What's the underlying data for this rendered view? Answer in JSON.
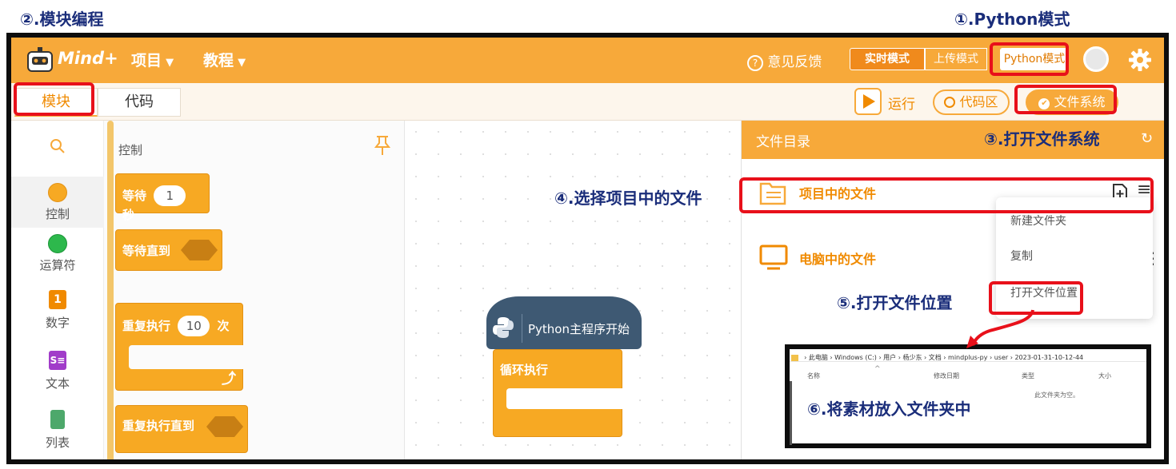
{
  "annotations": {
    "a1": "①.Python模式",
    "a2": "②.模块编程",
    "a3": "③.打开文件系统",
    "a4": "④.选择项目中的文件",
    "a5": "⑤.打开文件位置",
    "a6": "⑥.将素材放入文件夹中"
  },
  "topbar": {
    "logo_text": "Mind+",
    "menu_project": "项目",
    "menu_tutorial": "教程",
    "feedback": "意见反馈",
    "mode_realtime": "实时模式",
    "mode_upload": "上传模式",
    "mode_python": "Python模式"
  },
  "subbar": {
    "tab_blocks": "模块",
    "tab_code": "代码",
    "run": "运行",
    "code_area": "代码区",
    "file_system": "文件系统"
  },
  "categories": [
    {
      "label": "控制",
      "color": "#f7a923",
      "icon": "circle"
    },
    {
      "label": "运算符",
      "color": "#2db84c",
      "icon": "circle"
    },
    {
      "label": "数字",
      "color": "#f08a00",
      "icon": "number-one-icon"
    },
    {
      "label": "文本",
      "color": "#a13cc9",
      "icon": "text-s-icon"
    },
    {
      "label": "列表",
      "color": "#4da86b",
      "icon": "clipboard-icon"
    }
  ],
  "palette": {
    "title": "控制",
    "wait_prefix": "等待",
    "wait_value": "1",
    "wait_suffix": "秒",
    "wait_until": "等待直到",
    "repeat_prefix": "重复执行",
    "repeat_value": "10",
    "repeat_suffix": "次",
    "repeat_until": "重复执行直到"
  },
  "workspace": {
    "hat_label": "Python主程序开始",
    "loop_label": "循环执行"
  },
  "filepanel": {
    "header": "文件目录",
    "project_files": "项目中的文件",
    "computer_files": "电脑中的文件",
    "menu": [
      "新建文件夹",
      "复制",
      "打开文件位置"
    ]
  },
  "explorer": {
    "breadcrumb": "› 此电脑 › Windows (C:) › 用户 › 杨少东 › 文档 › mindplus-py › user › 2023-01-31-10-12-44",
    "col_name": "名称",
    "col_date": "修改日期",
    "col_type": "类型",
    "col_size": "大小",
    "empty": "此文件夹为空。"
  },
  "colors": {
    "accent": "#f7a93a",
    "annotation": "#1a2d7a",
    "highlight": "#e8101a",
    "block_orange": "#f7a923",
    "python_block": "#3e5973"
  }
}
